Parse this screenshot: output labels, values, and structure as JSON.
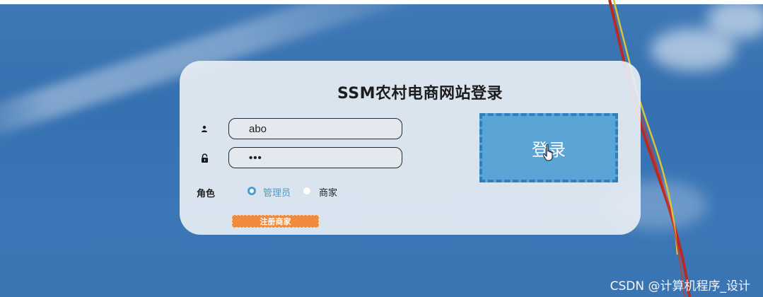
{
  "login": {
    "title": "SSM农村电商网站登录",
    "username_value": "abo",
    "password_value": "•••",
    "role_label": "角色",
    "roles": [
      {
        "label": "管理员",
        "selected": true
      },
      {
        "label": "商家",
        "selected": false
      }
    ],
    "login_button": "登录",
    "register_button": "注册商家"
  },
  "watermark": "CSDN @计算机程序_设计",
  "colors": {
    "accent": "#4a9ed0",
    "login_button_bg": "#5aa4d6",
    "register_button_bg": "#f08a3c",
    "panel_bg": "#e8eef4"
  },
  "icons": {
    "username": "user-icon",
    "password": "lock-icon",
    "cursor": "hand-pointer-icon"
  }
}
